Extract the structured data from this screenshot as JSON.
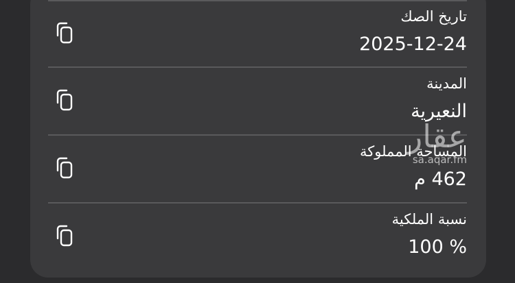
{
  "rows": [
    {
      "label": "تاريخ الصك",
      "value": "2025-12-24",
      "icon": "copy-icon"
    },
    {
      "label": "المدينة",
      "value": "النعيرية",
      "icon": "copy-icon"
    },
    {
      "label": "المساحة المملوكة",
      "value": "462 م",
      "icon": "copy-icon"
    },
    {
      "label": "نسبة الملكية",
      "value": "100 %",
      "icon": "copy-icon"
    }
  ],
  "watermark": {
    "logo": "عقار",
    "url": "sa.aqar.fm"
  },
  "colors": {
    "background": "#2b2b2d",
    "card": "#3a3a3c",
    "divider": "#5a5a5c",
    "text": "#ffffff"
  }
}
